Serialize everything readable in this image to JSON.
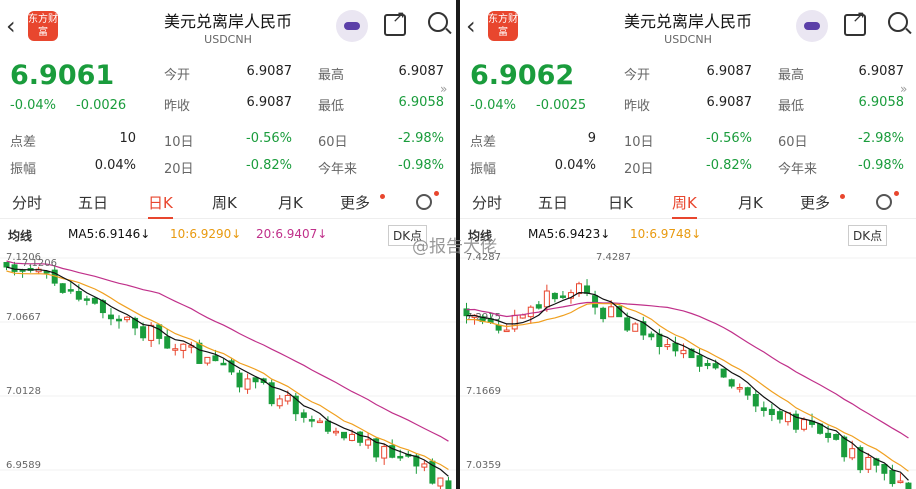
{
  "colors": {
    "green": "#1a9c3c",
    "red": "#e8462e",
    "ma5": "#111111",
    "ma10": "#f0a020",
    "ma20": "#c0308a"
  },
  "watermark": "@报告大佬",
  "panels": [
    {
      "header": {
        "title": "美元兑离岸人民币",
        "code": "USDCNH",
        "logo": "东方财富"
      },
      "price": "6.9061",
      "change_pct": "-0.04%",
      "change_abs": "-0.0026",
      "stats": {
        "open_label": "今开",
        "open": "6.9087",
        "high_label": "最高",
        "high": "6.9087",
        "prev_label": "昨收",
        "prev": "6.9087",
        "low_label": "最低",
        "low": "6.9058",
        "spread_label": "点差",
        "spread": "10",
        "d10_label": "10日",
        "d10": "-0.56%",
        "d60_label": "60日",
        "d60": "-2.98%",
        "amp_label": "振幅",
        "amp": "0.04%",
        "d20_label": "20日",
        "d20": "-0.82%",
        "ytd_label": "今年来",
        "ytd": "-0.98%"
      },
      "tabs": [
        "分时",
        "五日",
        "日K",
        "周K",
        "月K",
        "更多"
      ],
      "active_tab": "日K",
      "ma": {
        "junxian": "均线",
        "ma5": "MA5:6.9146↓",
        "ma10": "10:6.9290↓",
        "ma20": "20:6.9407↓"
      },
      "dk": "DK点",
      "y_labels": [
        "7.1206",
        "7.0667",
        "7.0128",
        "6.9589"
      ],
      "high_marker": "7.1206",
      "chart_data": {
        "type": "candlestick",
        "y_ticks": [
          7.1206,
          7.0667,
          7.0128,
          6.9589
        ],
        "moving_averages": {
          "MA5": 6.9146,
          "MA10": 6.929,
          "MA20": 6.9407
        },
        "max_marker": 7.1206
      }
    },
    {
      "header": {
        "title": "美元兑离岸人民币",
        "code": "USDCNH",
        "logo": "东方财富"
      },
      "price": "6.9062",
      "change_pct": "-0.04%",
      "change_abs": "-0.0025",
      "stats": {
        "open_label": "今开",
        "open": "6.9087",
        "high_label": "最高",
        "high": "6.9087",
        "prev_label": "昨收",
        "prev": "6.9087",
        "low_label": "最低",
        "low": "6.9058",
        "spread_label": "点差",
        "spread": "9",
        "d10_label": "10日",
        "d10": "-0.56%",
        "d60_label": "60日",
        "d60": "-2.98%",
        "amp_label": "振幅",
        "amp": "0.04%",
        "d20_label": "20日",
        "d20": "-0.82%",
        "ytd_label": "今年来",
        "ytd": "-0.98%"
      },
      "tabs": [
        "分时",
        "五日",
        "日K",
        "周K",
        "月K",
        "更多"
      ],
      "active_tab": "周K",
      "ma": {
        "junxian": "均线",
        "ma5": "MA5:6.9423↓",
        "ma10": "10:6.9748↓",
        "ma20": ""
      },
      "dk": "DK点",
      "y_labels": [
        "7.4287",
        "7.2975",
        "7.1669",
        "7.0359"
      ],
      "high_marker": "7.4287",
      "chart_data": {
        "type": "candlestick",
        "y_ticks": [
          7.4287,
          7.2975,
          7.1669,
          7.0359
        ],
        "moving_averages": {
          "MA5": 6.9423,
          "MA10": 6.9748
        },
        "max_marker": 7.4287
      }
    }
  ]
}
